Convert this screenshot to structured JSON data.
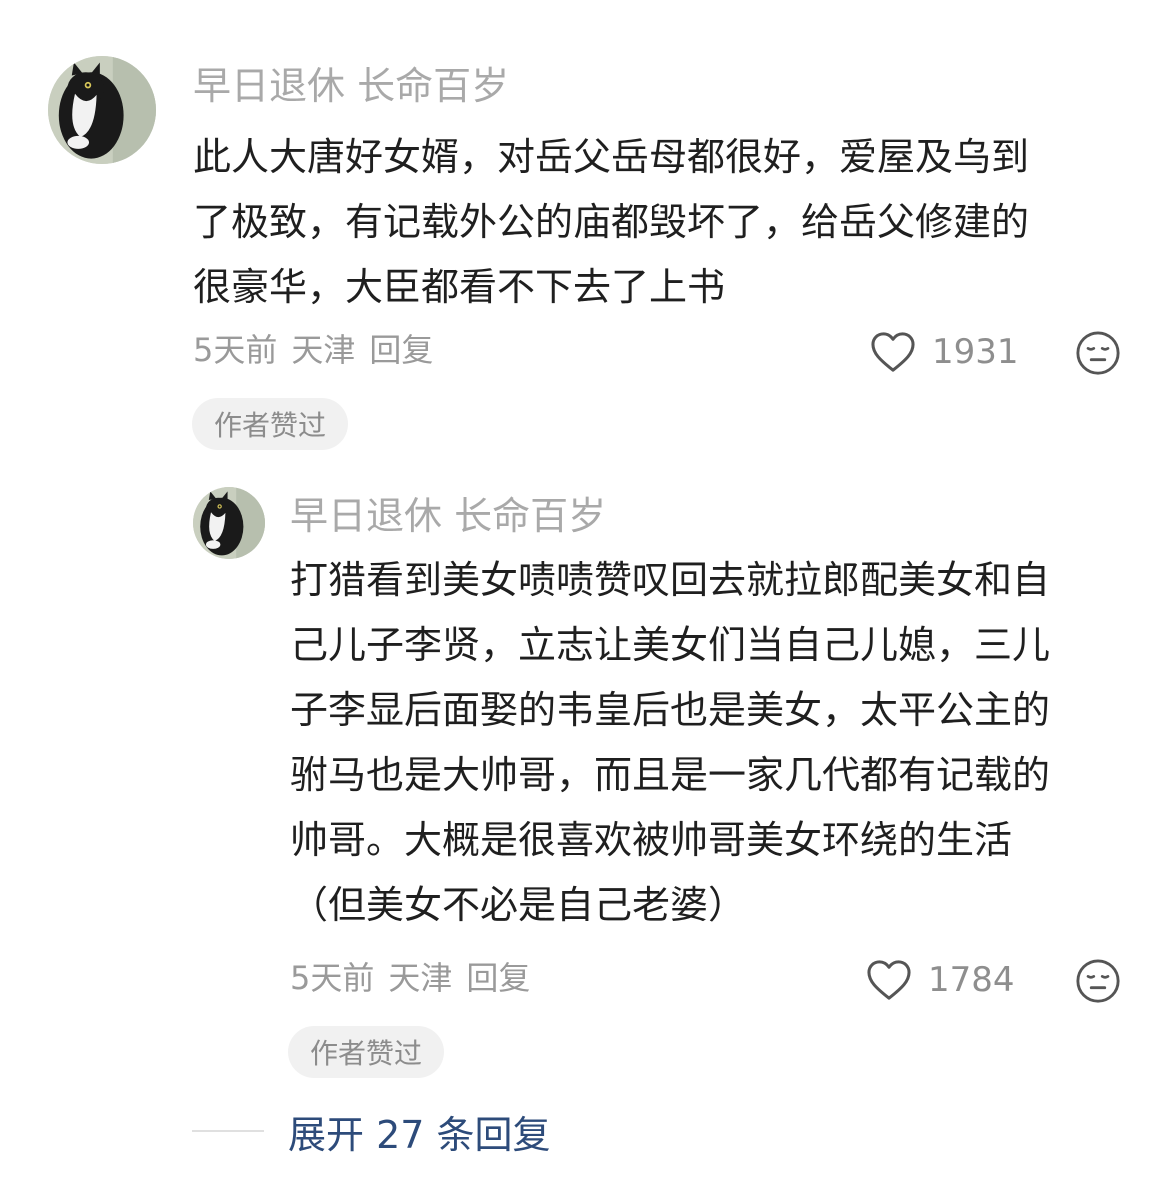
{
  "main_comment": {
    "username": "早日退休 长命百岁",
    "content_lines": [
      "此人大唐好女婿，对岳父岳母都很好，爱屋及乌到",
      "了极致，有记载外公的庙都毁坏了，给岳父修建的",
      "很豪华，大臣都看不下去了上书"
    ],
    "time": "5天前",
    "location": "天津",
    "reply_label": "回复",
    "like_count": "1931",
    "badge": "作者赞过"
  },
  "reply_comment": {
    "username": "早日退休 长命百岁",
    "content_lines": [
      "打猎看到美女啧啧赞叹回去就拉郎配美女和自",
      "己儿子李贤，立志让美女们当自己儿媳，三儿",
      "子李显后面娶的韦皇后也是美女，太平公主的",
      "驸马也是大帅哥，而且是一家几代都有记载的",
      "帅哥。大概是很喜欢被帅哥美女环绕的生活",
      "（但美女不必是自己老婆）"
    ],
    "time": "5天前",
    "location": "天津",
    "reply_label": "回复",
    "like_count": "1784",
    "badge": "作者赞过"
  },
  "expand": {
    "label": "展开 27 条回复"
  },
  "icons": {
    "heart": "heart-icon",
    "dislike": "dislike-face-icon",
    "avatar": "cat-avatar"
  },
  "colors": {
    "username": "#a9a9a9",
    "meta": "#9a9a9a",
    "link": "#2d4b7a",
    "badge_bg": "#f1f1f1"
  }
}
